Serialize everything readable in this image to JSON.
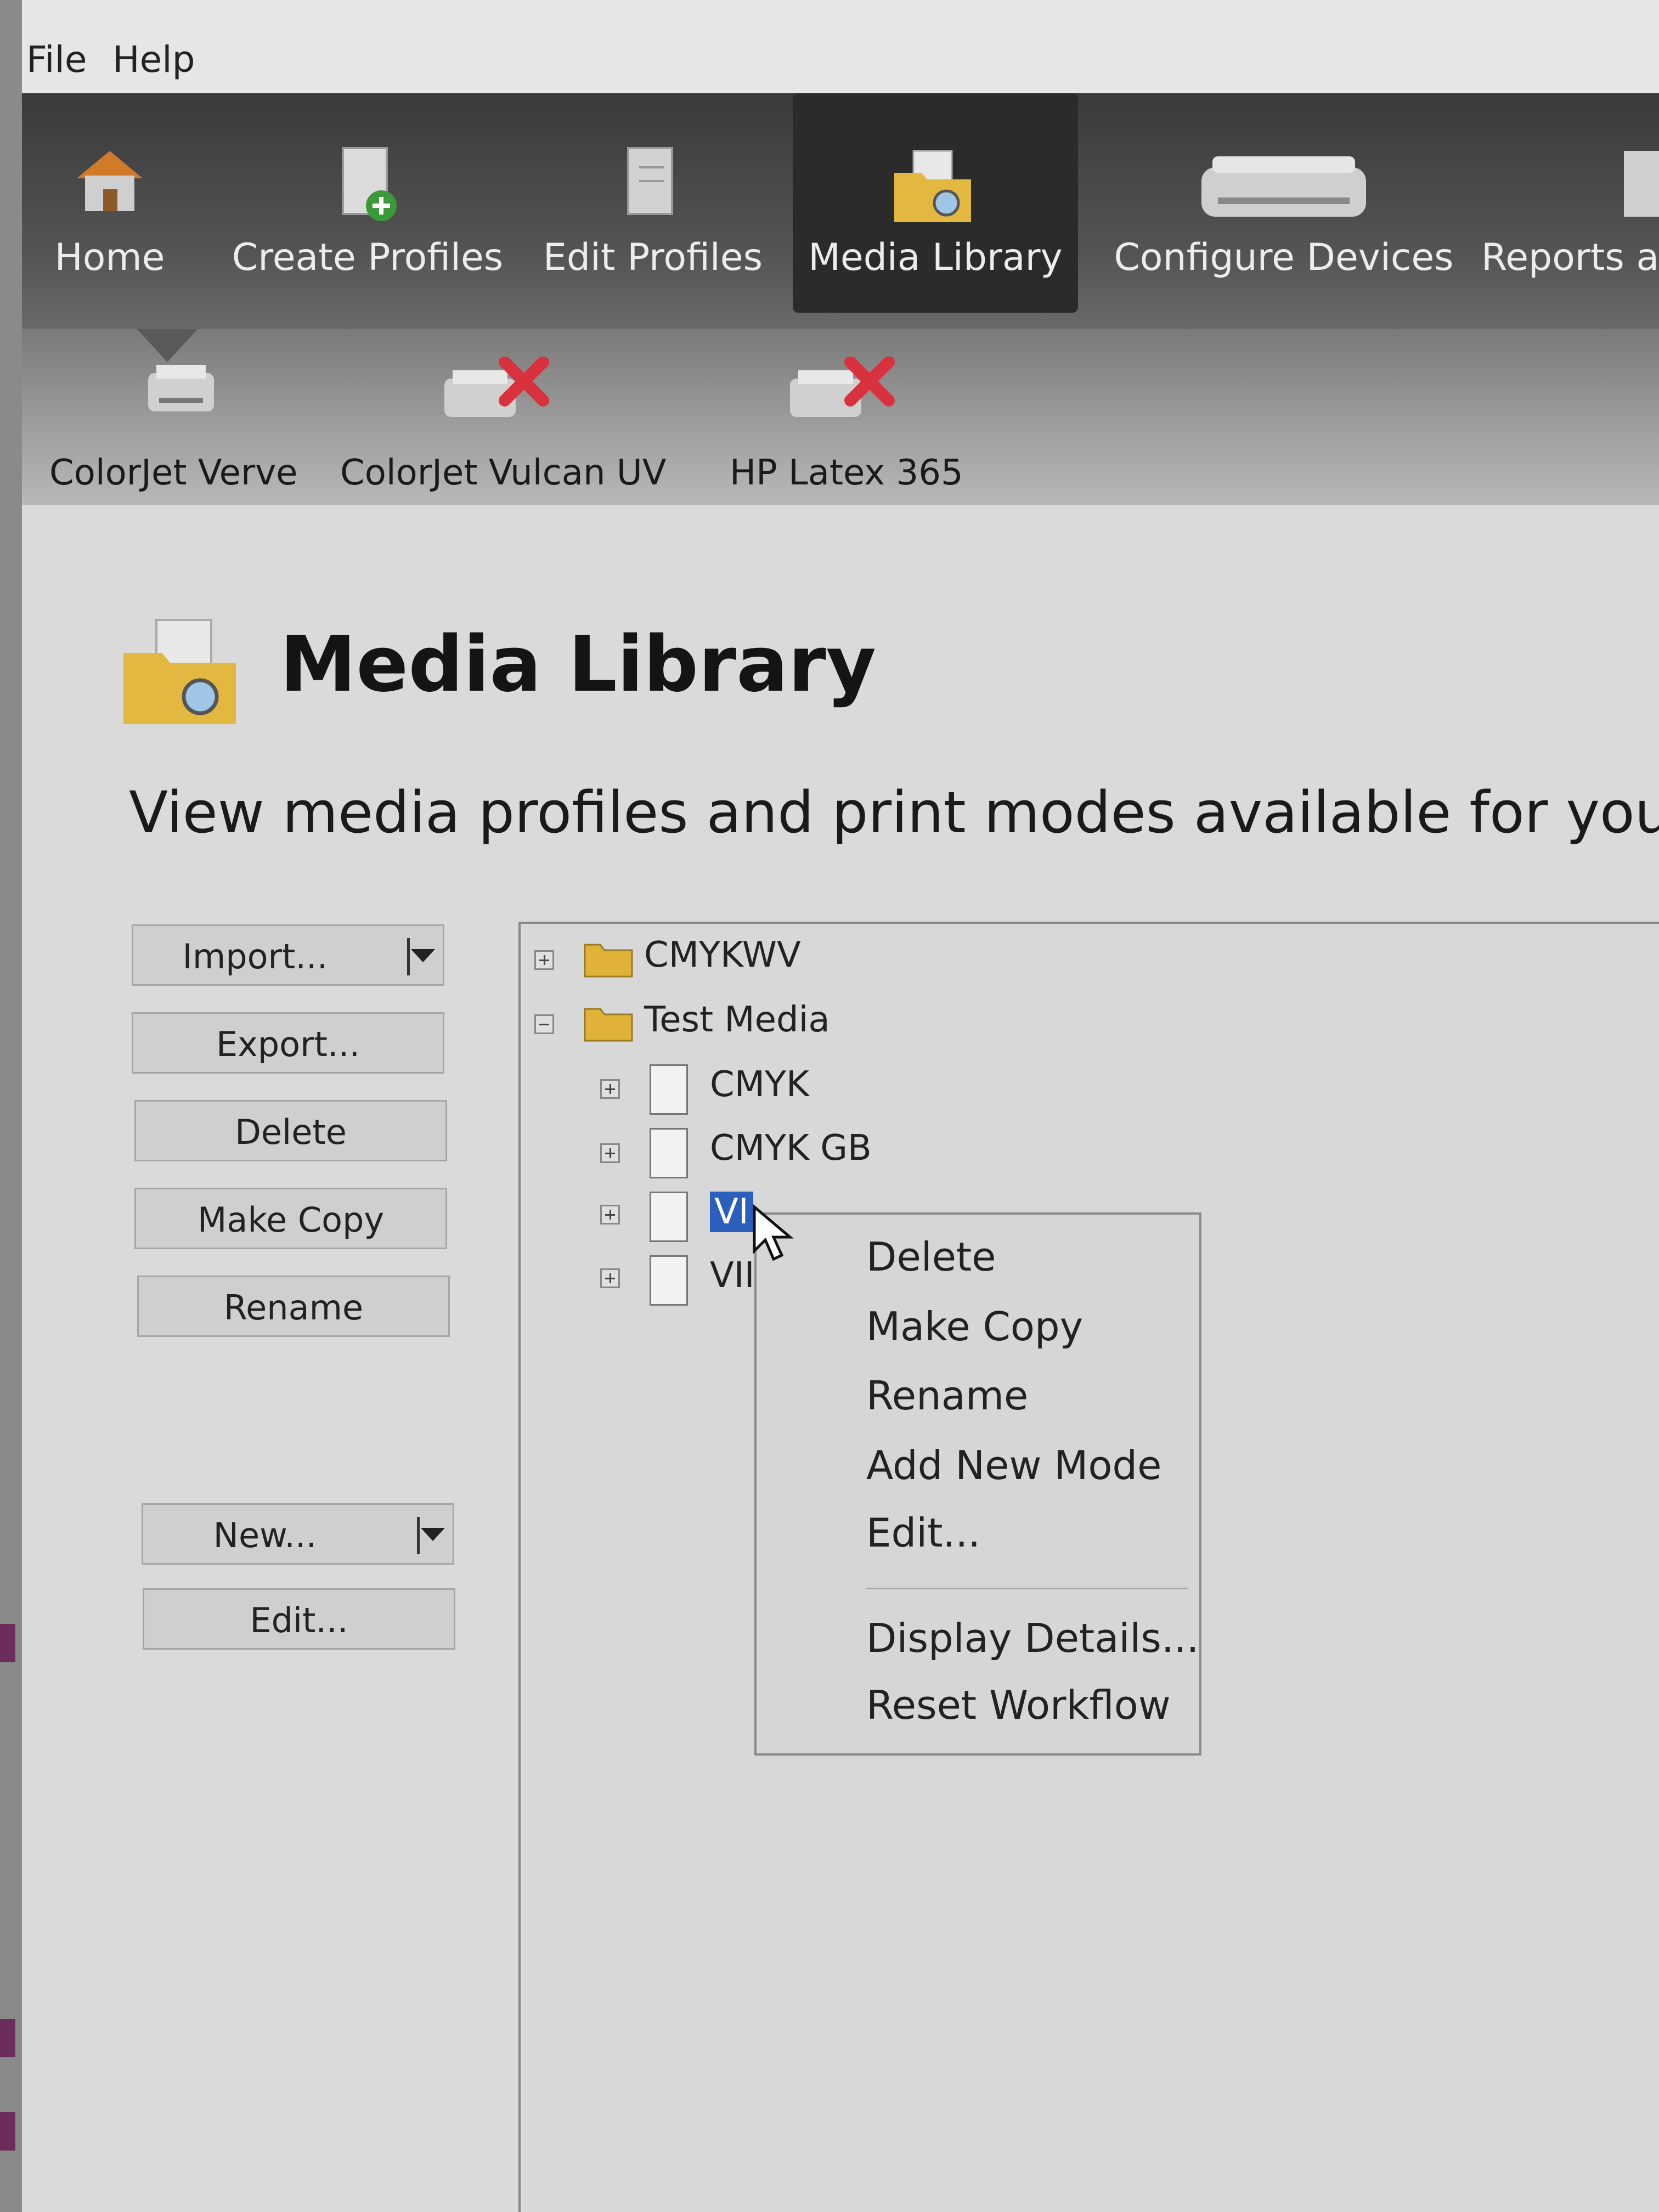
{
  "menubar": {
    "file": "File",
    "help": "Help"
  },
  "toolbar": {
    "items": [
      {
        "label": "Home",
        "icon": "home-icon"
      },
      {
        "label": "Create Profiles",
        "icon": "create-profile-icon"
      },
      {
        "label": "Edit Profiles",
        "icon": "edit-profile-icon"
      },
      {
        "label": "Media Library",
        "icon": "media-library-icon",
        "active": true
      },
      {
        "label": "Configure Devices",
        "icon": "printer-icon"
      },
      {
        "label": "Reports a",
        "icon": "reports-icon"
      }
    ]
  },
  "devices": [
    {
      "label": "ColorJet Verve",
      "status": "connected"
    },
    {
      "label": "ColorJet Vulcan UV",
      "status": "disconnected"
    },
    {
      "label": "HP Latex 365",
      "status": "disconnected"
    }
  ],
  "page": {
    "title": "Media Library",
    "subtitle": "View media profiles and print modes available for your"
  },
  "actions": {
    "import": "Import...",
    "export": "Export...",
    "delete": "Delete",
    "make_copy": "Make Copy",
    "rename": "Rename",
    "new": "New...",
    "edit": "Edit..."
  },
  "tree": {
    "folders": [
      {
        "label": "CMYKWV",
        "expanded": false
      },
      {
        "label": "Test Media",
        "expanded": true
      }
    ],
    "children": [
      {
        "label": "CMYK"
      },
      {
        "label": "CMYK GB"
      },
      {
        "label": "VINYL",
        "visible": "VI",
        "selected": true
      },
      {
        "label": "VI",
        "visible": "VII"
      }
    ]
  },
  "context_menu": {
    "items": [
      "Delete",
      "Make Copy",
      "Rename",
      "Add New Mode",
      "Edit..."
    ],
    "items2": [
      "Display Details...",
      "Reset Workflow"
    ]
  },
  "colors": {
    "selection": "#2b5fbd",
    "toolbar": "#3a3a3a",
    "error_x": "#d8323f"
  }
}
